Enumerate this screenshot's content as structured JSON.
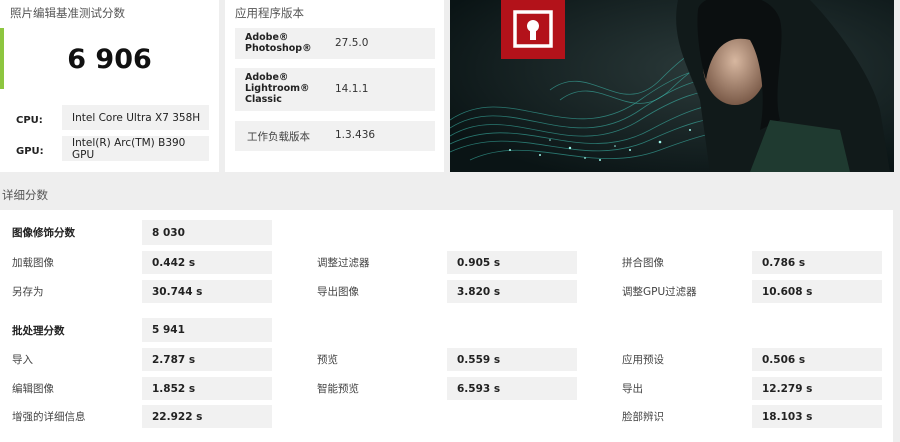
{
  "score_card": {
    "title": "照片编辑基准测试分数",
    "score": "6 906",
    "cpu_label": "CPU:",
    "cpu_value": "Intel Core Ultra X7 358H",
    "gpu_label": "GPU:",
    "gpu_value": "Intel(R) Arc(TM) B390 GPU",
    "accent_color": "#8dc63f"
  },
  "version_card": {
    "title": "应用程序版本",
    "rows": [
      {
        "name_lines": [
          "Adobe®",
          "Photoshop®"
        ],
        "value": "27.5.0"
      },
      {
        "name_lines": [
          "Adobe®",
          "Lightroom®",
          "Classic"
        ],
        "value": "14.1.1"
      },
      {
        "name_lines": [
          "工作负载版本"
        ],
        "value": "1.3.436"
      }
    ]
  },
  "hero": {
    "logo_color": "#b3121a",
    "logo_icon": "adobe-lightroom-logo-icon"
  },
  "details": {
    "title": "详细分数",
    "retouch": {
      "label": "图像修饰分数",
      "score": "8 030",
      "items": [
        {
          "label": "加载图像",
          "value": "0.442 s"
        },
        {
          "label": "调整过滤器",
          "value": "0.905 s"
        },
        {
          "label": "拼合图像",
          "value": "0.786 s"
        },
        {
          "label": "另存为",
          "value": "30.744 s"
        },
        {
          "label": "导出图像",
          "value": "3.820 s"
        },
        {
          "label": "调整GPU过滤器",
          "value": "10.608 s"
        }
      ]
    },
    "batch": {
      "label": "批处理分数",
      "score": "5 941",
      "items": [
        {
          "label": "导入",
          "value": "2.787 s"
        },
        {
          "label": "预览",
          "value": "0.559 s"
        },
        {
          "label": "应用预设",
          "value": "0.506 s"
        },
        {
          "label": "编辑图像",
          "value": "1.852 s"
        },
        {
          "label": "智能预览",
          "value": "6.593 s"
        },
        {
          "label": "导出",
          "value": "12.279 s"
        },
        {
          "label": "增强的详细信息",
          "value": "22.922 s"
        },
        {
          "label": "脸部辨识",
          "value": "18.103 s"
        }
      ]
    }
  }
}
